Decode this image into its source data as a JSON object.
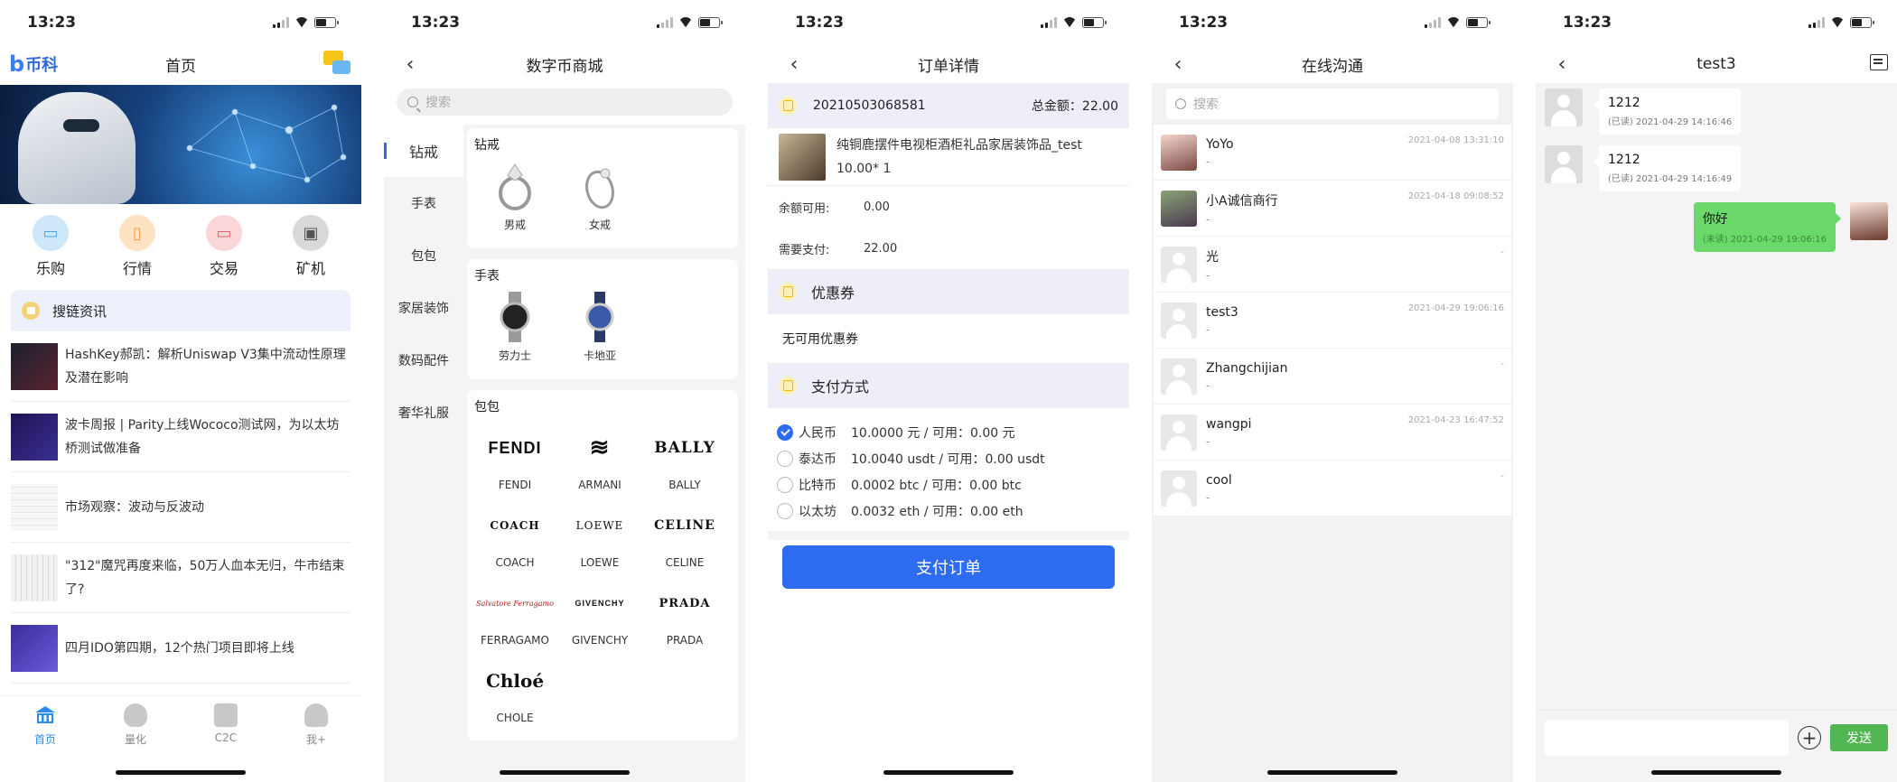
{
  "status": {
    "time": "13:23"
  },
  "screen1": {
    "logo_b": "b",
    "logo_text": "币科",
    "title": "首页",
    "quick": [
      {
        "label": "乐购",
        "icon": "monitor-icon",
        "color": "#cfe8f9",
        "glyph": "▭"
      },
      {
        "label": "行情",
        "icon": "chart-icon",
        "color": "#fde3c2",
        "glyph": "▯"
      },
      {
        "label": "交易",
        "icon": "card-icon",
        "color": "#fad6d8",
        "glyph": "▭"
      },
      {
        "label": "矿机",
        "icon": "chip-icon",
        "color": "#d9d9d9",
        "glyph": "▣"
      }
    ],
    "news_header": "搜链资讯",
    "news": [
      {
        "text": "HashKey郝凯：解析Uniswap V3集中流动性原理及潜在影响",
        "thumb": "#1c1f2e"
      },
      {
        "text": "波卡周报 | Parity上线Wococo测试网，为以太坊桥测试做准备",
        "thumb": "#1e1452"
      },
      {
        "text": "市场观察：波动与反波动",
        "thumb": "#f3f3f3"
      },
      {
        "text": "\"312\"魔咒再度来临，50万人血本无归，牛市结束了?",
        "thumb": "#e9e9e9"
      },
      {
        "text": "四月IDO第四期，12个热门项目即将上线",
        "thumb": "#3a2e9c"
      }
    ],
    "tabs": [
      {
        "label": "首页",
        "active": true
      },
      {
        "label": "量化",
        "active": false
      },
      {
        "label": "C2C",
        "active": false
      },
      {
        "label": "我+",
        "active": false
      }
    ]
  },
  "screen2": {
    "title": "数字币商城",
    "search_placeholder": "搜索",
    "categories": [
      "钻戒",
      "手表",
      "包包",
      "家居装饰",
      "数码配件",
      "奢华礼服"
    ],
    "sections": [
      {
        "title": "钻戒",
        "items": [
          {
            "name": "男戒",
            "kind": "ring"
          },
          {
            "name": "女戒",
            "kind": "ring"
          }
        ]
      },
      {
        "title": "手表",
        "items": [
          {
            "name": "劳力士",
            "kind": "watch-dark"
          },
          {
            "name": "卡地亚",
            "kind": "watch-blue"
          }
        ]
      },
      {
        "title": "包包",
        "items": [
          {
            "name": "FENDI",
            "logo": "FENDI"
          },
          {
            "name": "ARMANI",
            "logo": "≋"
          },
          {
            "name": "BALLY",
            "logo": "BALLY"
          },
          {
            "name": "COACH",
            "logo": "COACH"
          },
          {
            "name": "LOEWE",
            "logo": "LOEWE"
          },
          {
            "name": "CELINE",
            "logo": "CELINE"
          },
          {
            "name": "FERRAGAMO",
            "logo": "Salvatore Ferragamo"
          },
          {
            "name": "GIVENCHY",
            "logo": "GIVENCHY"
          },
          {
            "name": "PRADA",
            "logo": "PRADA"
          },
          {
            "name": "CHOLE",
            "logo": "Chloé"
          }
        ]
      }
    ]
  },
  "screen3": {
    "title": "订单详情",
    "order_no": "20210503068581",
    "total_label": "总金额：22.00",
    "product_name": "纯铜鹿摆件电视柜酒柜礼品家居装饰品_test",
    "product_price": "10.00* 1",
    "balance_label": "余额可用:",
    "balance_value": "0.00",
    "need_label": "需要支付:",
    "need_value": "22.00",
    "coupon_title": "优惠券",
    "coupon_none": "无可用优惠券",
    "pay_title": "支付方式",
    "pay_options": [
      {
        "name": "人民币",
        "detail": "10.0000 元 / 可用：0.00 元",
        "checked": true
      },
      {
        "name": "泰达币",
        "detail": "10.0040 usdt / 可用：0.00 usdt",
        "checked": false
      },
      {
        "name": "比特币",
        "detail": "0.0002 btc / 可用：0.00 btc",
        "checked": false
      },
      {
        "name": "以太坊",
        "detail": "0.0032 eth / 可用：0.00 eth",
        "checked": false
      }
    ],
    "pay_button": "支付订单"
  },
  "screen4": {
    "title": "在线沟通",
    "search_placeholder": "搜索",
    "contacts": [
      {
        "name": "YoYo",
        "sub": "-",
        "time": "2021-04-08 13:31:10",
        "avatar": "ph1"
      },
      {
        "name": "小A诚信商行",
        "sub": "-",
        "time": "2021-04-18 09:08:52",
        "avatar": "ph2"
      },
      {
        "name": "光",
        "sub": "-",
        "time": "-",
        "avatar": "gen"
      },
      {
        "name": "test3",
        "sub": "-",
        "time": "2021-04-29 19:06:16",
        "avatar": "gen"
      },
      {
        "name": "Zhangchijian",
        "sub": "-",
        "time": "-",
        "avatar": "gen"
      },
      {
        "name": "wangpi",
        "sub": "-",
        "time": "2021-04-23 16:47:52",
        "avatar": "gen"
      },
      {
        "name": "cool",
        "sub": "-",
        "time": "-",
        "avatar": "gen"
      }
    ]
  },
  "screen5": {
    "title": "test3",
    "messages": [
      {
        "text": "1212",
        "status": "(已读) 2021-04-29 14:16:46",
        "mine": false
      },
      {
        "text": "1212",
        "status": "(已读) 2021-04-29 14:16:49",
        "mine": false
      },
      {
        "text": "你好",
        "status": "(未读) 2021-04-29 19:06:16",
        "mine": true
      }
    ],
    "send_label": "发送"
  }
}
